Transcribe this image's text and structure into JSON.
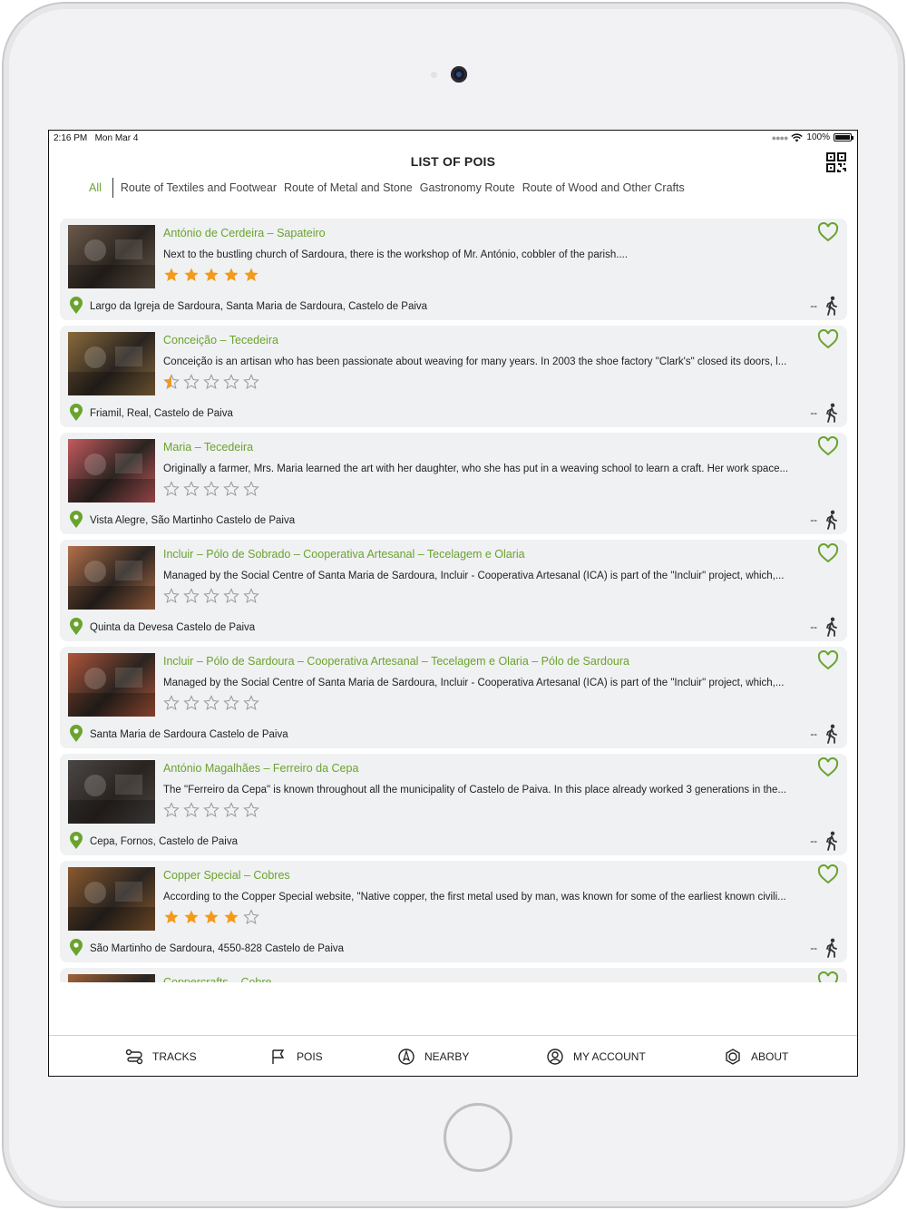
{
  "status": {
    "time": "2:16 PM",
    "date": "Mon Mar 4",
    "battery": "100%"
  },
  "header": {
    "title": "LIST OF POIS"
  },
  "filters": [
    {
      "label": "All",
      "active": true
    },
    {
      "label": "Route of Textiles and Footwear",
      "active": false
    },
    {
      "label": "Route of Metal and Stone",
      "active": false
    },
    {
      "label": "Gastronomy Route",
      "active": false
    },
    {
      "label": "Route of Wood and Other Crafts",
      "active": false
    }
  ],
  "pois": [
    {
      "name": "António de Cerdeira – Sapateiro",
      "description": "Next to the bustling church of Sardoura, there is the workshop of Mr. António, cobbler of the parish....",
      "rating": 5,
      "address": "Largo da Igreja de Sardoura, Santa Maria de Sardoura, Castelo de Paiva",
      "distance": "--",
      "thumb_color": "#6b5a4a"
    },
    {
      "name": "Conceição – Tecedeira",
      "description": "Conceição is an artisan who has been passionate about weaving for many years. In 2003 the shoe factory \"Clark's\" closed its doors, l...",
      "rating": 0.5,
      "address": "Friamil, Real, Castelo de Paiva",
      "distance": "--",
      "thumb_color": "#8a6a3c"
    },
    {
      "name": "Maria – Tecedeira",
      "description": "Originally a farmer, Mrs. Maria learned the art with her daughter, who she has put in a weaving school to learn a craft. Her work space...",
      "rating": 0,
      "address": "Vista Alegre, São Martinho Castelo de Paiva",
      "distance": "--",
      "thumb_color": "#c55a5e"
    },
    {
      "name": "Incluir – Pólo de Sobrado – Cooperativa Artesanal  – Tecelagem e Olaria",
      "description": "Managed by the Social Centre of Santa Maria de Sardoura, Incluir - Cooperativa Artesanal (ICA) is part of the \"Incluir\" project, which,...",
      "rating": 0,
      "address": "Quinta da Devesa Castelo de Paiva",
      "distance": "--",
      "thumb_color": "#b5704a"
    },
    {
      "name": "Incluir – Pólo de Sardoura – Cooperativa Artesanal  – Tecelagem e Olaria – Pólo de Sardoura",
      "description": "Managed by the Social Centre of Santa Maria de Sardoura, Incluir - Cooperativa Artesanal (ICA) is part of the \"Incluir\" project, which,...",
      "rating": 0,
      "address": "Santa Maria de Sardoura Castelo de Paiva",
      "distance": "--",
      "thumb_color": "#b0563a"
    },
    {
      "name": "António Magalhães – Ferreiro da Cepa",
      "description": "The \"Ferreiro da Cepa\" is known throughout all the municipality of Castelo de Paiva. In this place already worked 3 generations in the...",
      "rating": 0,
      "address": "Cepa, Fornos, Castelo de Paiva",
      "distance": "--",
      "thumb_color": "#4a4644"
    },
    {
      "name": "Copper Special – Cobres",
      "description": "According to the Copper Special website, \"Native copper, the first metal used by man, was known for some of the earliest known civili...",
      "rating": 4,
      "address": "São Martinho de Sardoura, 4550-828 Castelo de Paiva",
      "distance": "--",
      "thumb_color": "#8a5a2e"
    },
    {
      "name": "Coppercrafts – Cobre",
      "description": "",
      "rating": 0,
      "address": "",
      "distance": "--",
      "thumb_color": "#a0623a"
    }
  ],
  "nav": [
    {
      "label": "TRACKS",
      "icon": "route-icon"
    },
    {
      "label": "POIS",
      "icon": "flag-icon"
    },
    {
      "label": "NEARBY",
      "icon": "compass-icon"
    },
    {
      "label": "MY ACCOUNT",
      "icon": "user-circle-icon"
    },
    {
      "label": "ABOUT",
      "icon": "info-shape-icon"
    }
  ],
  "colors": {
    "accent": "#6aa32e",
    "star": "#f39a1b",
    "card_bg": "#f0f1f2"
  }
}
